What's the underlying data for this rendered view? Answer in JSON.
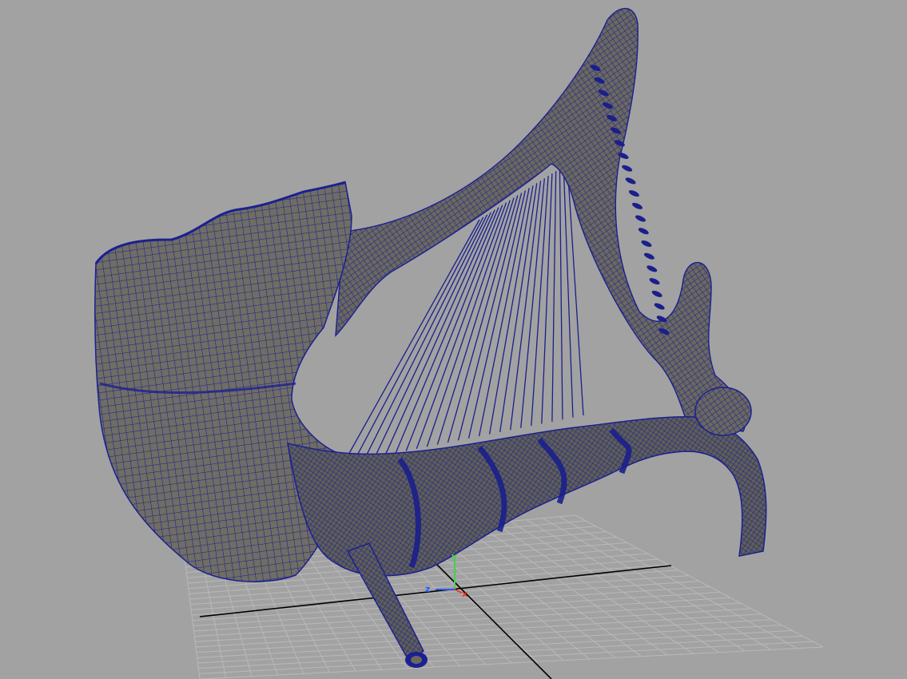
{
  "viewport": {
    "background": "#a2a2a2",
    "wireframe_color": "#1a1f8c",
    "surface_color": "#6d6b62",
    "grid_color": "#b9b9b9",
    "grid_axis_color": "#000000"
  },
  "axes_gizmo": {
    "y_label": "y",
    "z_label": "z",
    "x_label": "x",
    "y_color": "#3fd34f",
    "z_color": "#2b55ff",
    "x_color": "#e23b2b"
  },
  "model": {
    "icon": "harp-horn-mesh-icon",
    "string_count": 24
  }
}
